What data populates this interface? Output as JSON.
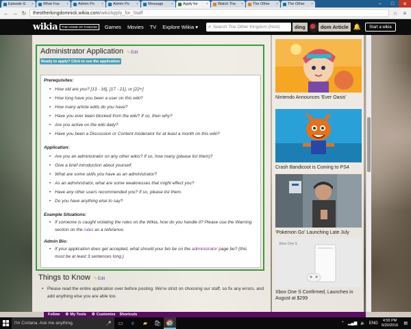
{
  "browser": {
    "tabs": [
      {
        "label": "Episode G",
        "active": false,
        "fav": "blue"
      },
      {
        "label": "What Foo",
        "active": false,
        "fav": "blue"
      },
      {
        "label": "Admin Po",
        "active": false,
        "fav": "blue"
      },
      {
        "label": "Admin Po",
        "active": false,
        "fav": "blue"
      },
      {
        "label": "Message",
        "active": false,
        "fav": "blue"
      },
      {
        "label": "Apply for",
        "active": true,
        "fav": "green"
      },
      {
        "label": "Watch The",
        "active": false,
        "fav": "orange"
      },
      {
        "label": "The Other",
        "active": false,
        "fav": "orange"
      },
      {
        "label": "The Other",
        "active": false,
        "fav": "blue"
      }
    ],
    "url_host": "theotherkingdomnick.wikia.com",
    "url_path": "/wiki/Apply_for_Staff"
  },
  "wikia_header": {
    "logo": "wikia",
    "tagline": "THE HOME OF FANDOM",
    "nav": [
      "Games",
      "Movies",
      "TV",
      "Explore Wikia ▾"
    ],
    "search_placeholder": "Search The Other Kingdom (Nick)",
    "trending": "ding",
    "trending2": "dom Article",
    "start_wiki": "Start a wikia"
  },
  "application": {
    "title": "Administrator Application",
    "edit_label": "Edit",
    "apply_button": "Ready to apply? Click to see the application",
    "prerequisites_title": "Prerequisites:",
    "prerequisites": [
      "How old are you? [13 - 16], [17 - 21], or [22+]",
      "How long have you been a user on this wiki?",
      "How many article edits do you have?",
      "Have you ever been blocked from the wiki? If so, then why?",
      "Are you active on the wiki daily?",
      "Have you been a Discussion or Content moderator for at least a month on this wiki?"
    ],
    "application_title": "Application:",
    "application_qs": [
      "Are you an administrator on any other wikis? If so, how many (please list them)?",
      "Give a brief introduction about yourself.",
      "What are some skills you have as an administrator?",
      "As an administrator, what are some weaknesses that might effect you?",
      "Have any other users recommended you? If so, please list them.",
      "Do you have anything else to say?"
    ],
    "situations_title": "Example Situations:",
    "situation_pre": "If someone is caught violating the rules on the Wikia, how do you handle it? Please use the Warning section on the ",
    "situation_link": "rules",
    "situation_post": " as a reference.",
    "bio_title": "Admin Bio:",
    "bio_pre": "If your application does get accepted, what should your bio be on the ",
    "bio_link": "administrator",
    "bio_post": " page be? (this must be at least 3 sentences long.)"
  },
  "things": {
    "title": "Things to Know",
    "edit_label": "Edit",
    "text": "Please read the entire application over before posting. We're strict on choosing our staff, so fix any errors, and add anything else you are able too."
  },
  "rail": [
    {
      "caption": "Nintendo Announces 'Ever Oasis'"
    },
    {
      "caption": "Crash Bandicoot is Coming to PS4"
    },
    {
      "caption": "'Pokemon Go' Launching Late July"
    },
    {
      "caption": "Xbox One S Confirmed, Launches in August at $299",
      "image_text": "Xbox One S"
    }
  ],
  "wikia_toolbar": {
    "follow": "Follow",
    "mytools": "My Tools",
    "customize": "Customize",
    "shortcuts": "Shortcuts"
  },
  "taskbar": {
    "cortana": "I'm Cortana. Ask me anything.",
    "lang": "ENG",
    "time": "4:55 PM",
    "date": "6/20/2016"
  }
}
